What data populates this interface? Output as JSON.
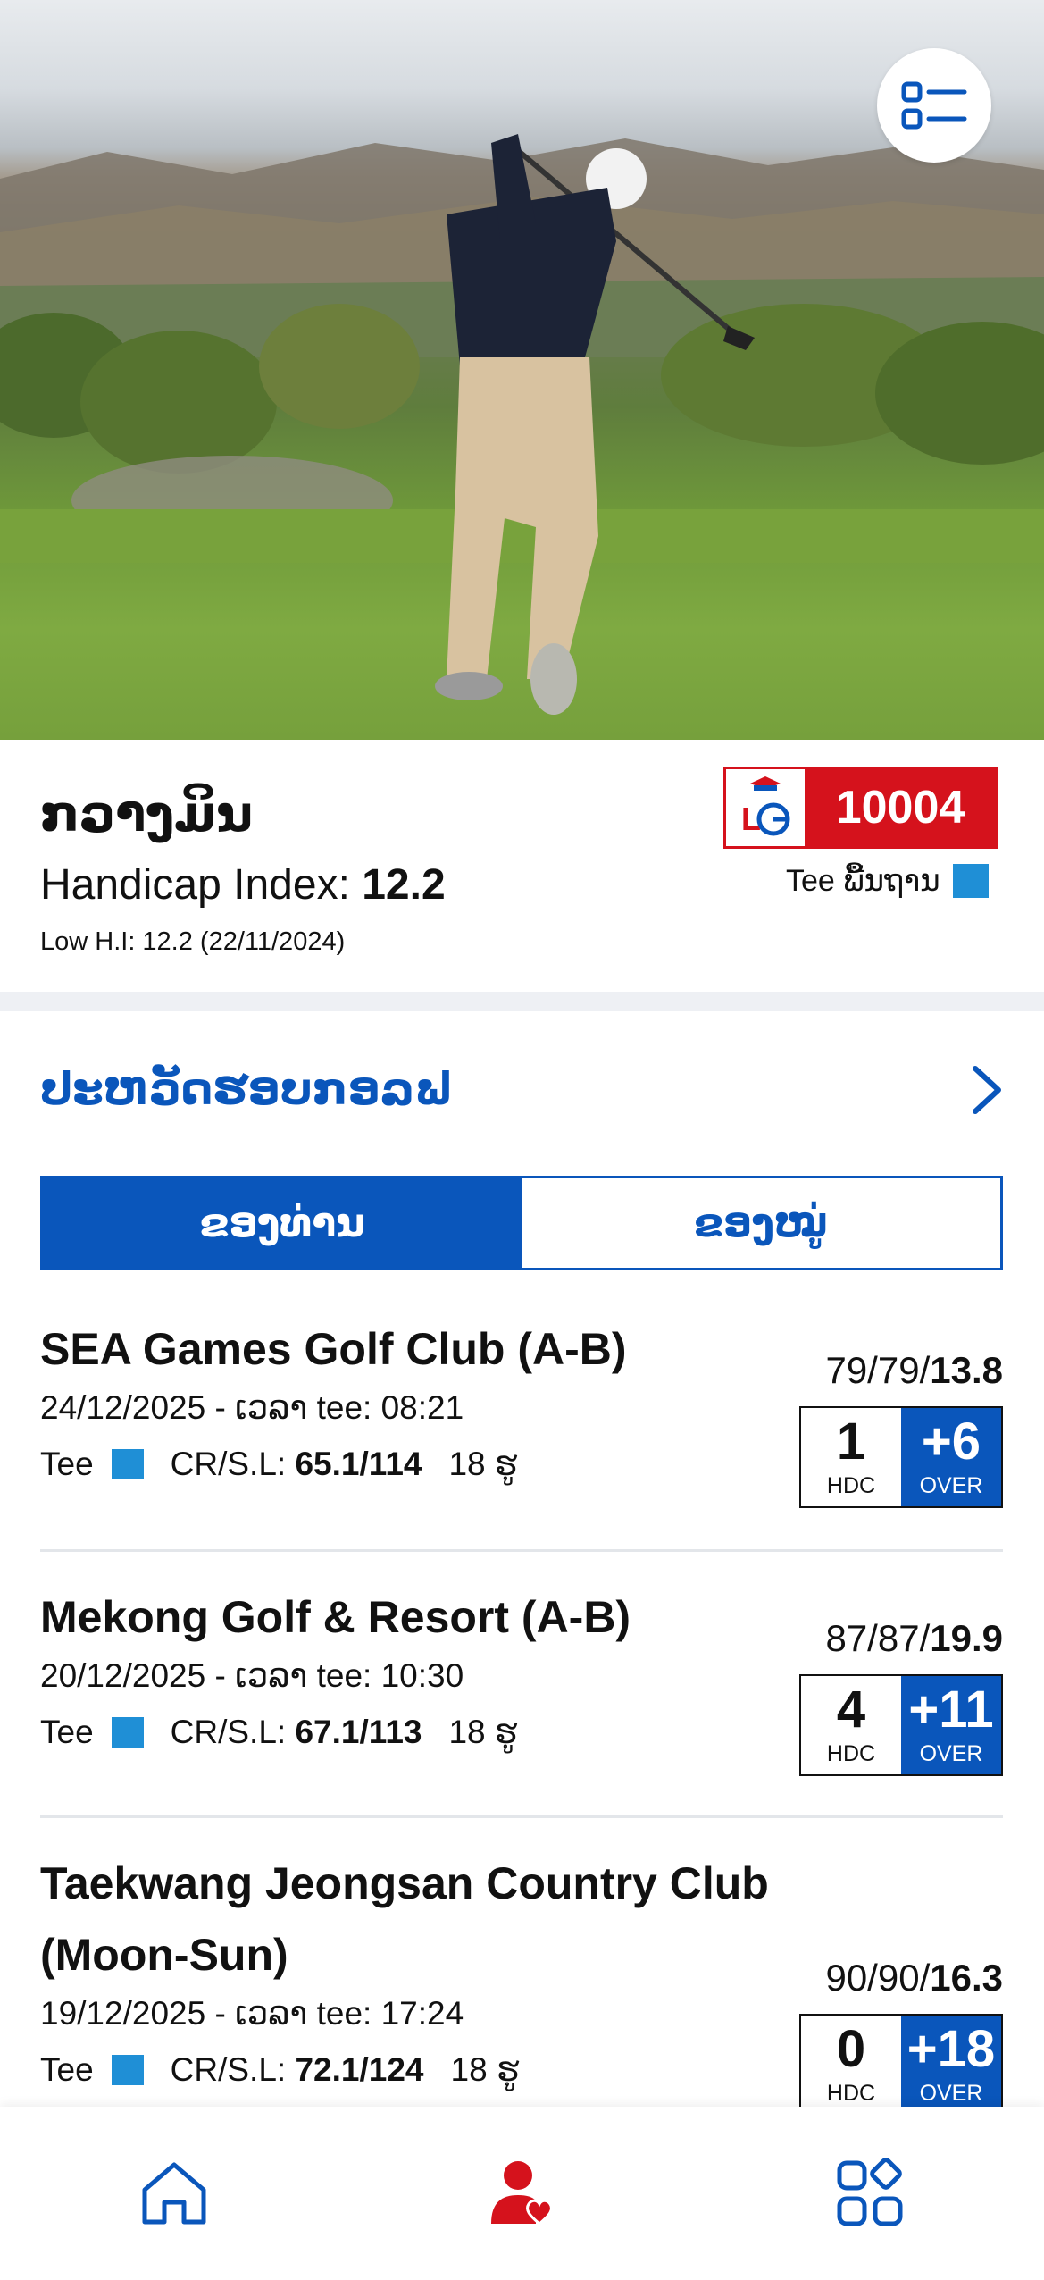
{
  "hero": {
    "menu_icon": "list-icon"
  },
  "profile": {
    "name": "ກວາງມິນ",
    "handicap_label": "Handicap Index: ",
    "handicap_value": "12.2",
    "low_hi": "Low H.I: 12.2 (22/11/2024)",
    "member_number": "10004",
    "tee_label": "Tee ພື້ນຖານ",
    "tee_color": "#1f8fd6",
    "brand_color": "#d5121c"
  },
  "history": {
    "title": "ປະຫວັດຮອບກອລຟ",
    "tabs": [
      {
        "label": "ຂອງທ່ານ",
        "active": true
      },
      {
        "label": "ຂອງໝູ່",
        "active": false
      }
    ],
    "rounds": [
      {
        "course": "SEA Games Golf Club (A-B)",
        "date": "24/12/2025 - ເວລາ tee: 08:21",
        "tee": "Tee",
        "cr_label": "CR/S.L: ",
        "cr_value": "65.1/114",
        "holes": "18 ຮູ",
        "score_prefix": "79/79/",
        "score_diff": "13.8",
        "hdc": "1",
        "hdc_label": "HDC",
        "over": "+6",
        "over_label": "OVER"
      },
      {
        "course": "Mekong Golf & Resort (A-B)",
        "date": "20/12/2025 - ເວລາ tee: 10:30",
        "tee": "Tee",
        "cr_label": "CR/S.L: ",
        "cr_value": "67.1/113",
        "holes": "18 ຮູ",
        "score_prefix": "87/87/",
        "score_diff": "19.9",
        "hdc": "4",
        "hdc_label": "HDC",
        "over": "+11",
        "over_label": "OVER"
      },
      {
        "course_line1": "Taekwang Jeongsan Country Club",
        "course_line2": "(Moon-Sun)",
        "date": "19/12/2025 - ເວລາ tee: 17:24",
        "tee": "Tee",
        "cr_label": "CR/S.L: ",
        "cr_value": "72.1/124",
        "holes": "18 ຮູ",
        "score_prefix": "90/90/",
        "score_diff": "16.3",
        "hdc": "0",
        "hdc_label": "HDC",
        "over": "+18",
        "over_label": "OVER"
      }
    ]
  },
  "nav": {
    "items": [
      {
        "icon": "home-icon",
        "active": false
      },
      {
        "icon": "profile-heart-icon",
        "active": true
      },
      {
        "icon": "apps-grid-icon",
        "active": false
      }
    ],
    "active_color": "#d5121c",
    "inactive_color": "#0a56bb"
  }
}
